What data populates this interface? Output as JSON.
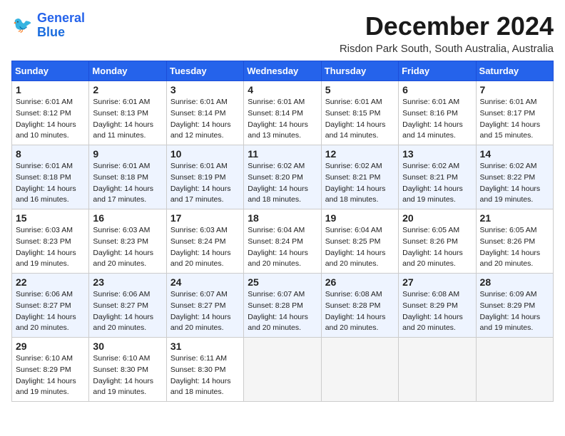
{
  "header": {
    "logo_line1": "General",
    "logo_line2": "Blue",
    "month_title": "December 2024",
    "subtitle": "Risdon Park South, South Australia, Australia"
  },
  "weekdays": [
    "Sunday",
    "Monday",
    "Tuesday",
    "Wednesday",
    "Thursday",
    "Friday",
    "Saturday"
  ],
  "weeks": [
    [
      {
        "day": "1",
        "sunrise": "6:01 AM",
        "sunset": "8:12 PM",
        "daylight": "14 hours and 10 minutes."
      },
      {
        "day": "2",
        "sunrise": "6:01 AM",
        "sunset": "8:13 PM",
        "daylight": "14 hours and 11 minutes."
      },
      {
        "day": "3",
        "sunrise": "6:01 AM",
        "sunset": "8:14 PM",
        "daylight": "14 hours and 12 minutes."
      },
      {
        "day": "4",
        "sunrise": "6:01 AM",
        "sunset": "8:14 PM",
        "daylight": "14 hours and 13 minutes."
      },
      {
        "day": "5",
        "sunrise": "6:01 AM",
        "sunset": "8:15 PM",
        "daylight": "14 hours and 14 minutes."
      },
      {
        "day": "6",
        "sunrise": "6:01 AM",
        "sunset": "8:16 PM",
        "daylight": "14 hours and 14 minutes."
      },
      {
        "day": "7",
        "sunrise": "6:01 AM",
        "sunset": "8:17 PM",
        "daylight": "14 hours and 15 minutes."
      }
    ],
    [
      {
        "day": "8",
        "sunrise": "6:01 AM",
        "sunset": "8:18 PM",
        "daylight": "14 hours and 16 minutes."
      },
      {
        "day": "9",
        "sunrise": "6:01 AM",
        "sunset": "8:18 PM",
        "daylight": "14 hours and 17 minutes."
      },
      {
        "day": "10",
        "sunrise": "6:01 AM",
        "sunset": "8:19 PM",
        "daylight": "14 hours and 17 minutes."
      },
      {
        "day": "11",
        "sunrise": "6:02 AM",
        "sunset": "8:20 PM",
        "daylight": "14 hours and 18 minutes."
      },
      {
        "day": "12",
        "sunrise": "6:02 AM",
        "sunset": "8:21 PM",
        "daylight": "14 hours and 18 minutes."
      },
      {
        "day": "13",
        "sunrise": "6:02 AM",
        "sunset": "8:21 PM",
        "daylight": "14 hours and 19 minutes."
      },
      {
        "day": "14",
        "sunrise": "6:02 AM",
        "sunset": "8:22 PM",
        "daylight": "14 hours and 19 minutes."
      }
    ],
    [
      {
        "day": "15",
        "sunrise": "6:03 AM",
        "sunset": "8:23 PM",
        "daylight": "14 hours and 19 minutes."
      },
      {
        "day": "16",
        "sunrise": "6:03 AM",
        "sunset": "8:23 PM",
        "daylight": "14 hours and 20 minutes."
      },
      {
        "day": "17",
        "sunrise": "6:03 AM",
        "sunset": "8:24 PM",
        "daylight": "14 hours and 20 minutes."
      },
      {
        "day": "18",
        "sunrise": "6:04 AM",
        "sunset": "8:24 PM",
        "daylight": "14 hours and 20 minutes."
      },
      {
        "day": "19",
        "sunrise": "6:04 AM",
        "sunset": "8:25 PM",
        "daylight": "14 hours and 20 minutes."
      },
      {
        "day": "20",
        "sunrise": "6:05 AM",
        "sunset": "8:26 PM",
        "daylight": "14 hours and 20 minutes."
      },
      {
        "day": "21",
        "sunrise": "6:05 AM",
        "sunset": "8:26 PM",
        "daylight": "14 hours and 20 minutes."
      }
    ],
    [
      {
        "day": "22",
        "sunrise": "6:06 AM",
        "sunset": "8:27 PM",
        "daylight": "14 hours and 20 minutes."
      },
      {
        "day": "23",
        "sunrise": "6:06 AM",
        "sunset": "8:27 PM",
        "daylight": "14 hours and 20 minutes."
      },
      {
        "day": "24",
        "sunrise": "6:07 AM",
        "sunset": "8:27 PM",
        "daylight": "14 hours and 20 minutes."
      },
      {
        "day": "25",
        "sunrise": "6:07 AM",
        "sunset": "8:28 PM",
        "daylight": "14 hours and 20 minutes."
      },
      {
        "day": "26",
        "sunrise": "6:08 AM",
        "sunset": "8:28 PM",
        "daylight": "14 hours and 20 minutes."
      },
      {
        "day": "27",
        "sunrise": "6:08 AM",
        "sunset": "8:29 PM",
        "daylight": "14 hours and 20 minutes."
      },
      {
        "day": "28",
        "sunrise": "6:09 AM",
        "sunset": "8:29 PM",
        "daylight": "14 hours and 19 minutes."
      }
    ],
    [
      {
        "day": "29",
        "sunrise": "6:10 AM",
        "sunset": "8:29 PM",
        "daylight": "14 hours and 19 minutes."
      },
      {
        "day": "30",
        "sunrise": "6:10 AM",
        "sunset": "8:30 PM",
        "daylight": "14 hours and 19 minutes."
      },
      {
        "day": "31",
        "sunrise": "6:11 AM",
        "sunset": "8:30 PM",
        "daylight": "14 hours and 18 minutes."
      },
      null,
      null,
      null,
      null
    ]
  ],
  "labels": {
    "sunrise": "Sunrise:",
    "sunset": "Sunset:",
    "daylight": "Daylight:"
  }
}
